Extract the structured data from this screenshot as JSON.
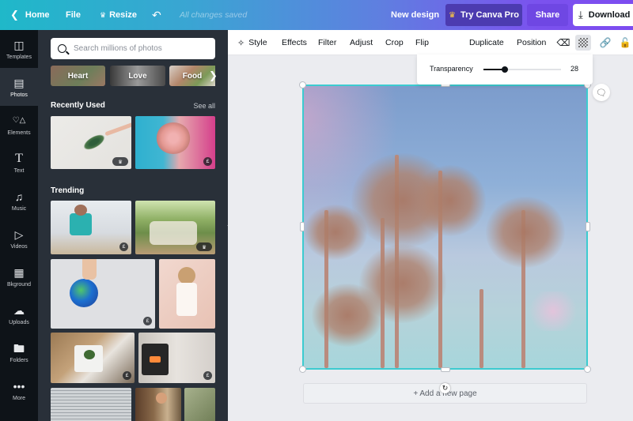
{
  "topbar": {
    "home": "Home",
    "file": "File",
    "resize": "Resize",
    "save_status": "All changes saved",
    "new_design": "New design",
    "try_pro": "Try Canva Pro",
    "share": "Share",
    "download": "Download"
  },
  "rail": {
    "items": [
      {
        "label": "Templates",
        "icon": "template-icon"
      },
      {
        "label": "Photos",
        "icon": "photo-icon"
      },
      {
        "label": "Elements",
        "icon": "shapes-icon"
      },
      {
        "label": "Text",
        "icon": "text-icon"
      },
      {
        "label": "Music",
        "icon": "music-icon"
      },
      {
        "label": "Videos",
        "icon": "video-icon"
      },
      {
        "label": "Bkground",
        "icon": "background-icon"
      },
      {
        "label": "Uploads",
        "icon": "upload-cloud-icon"
      },
      {
        "label": "Folders",
        "icon": "folder-icon"
      },
      {
        "label": "More",
        "icon": "more-icon"
      }
    ],
    "active": "Photos"
  },
  "panel": {
    "search_placeholder": "Search millions of photos",
    "chips": [
      "Heart",
      "Love",
      "Food"
    ],
    "recently_used_title": "Recently Used",
    "see_all": "See all",
    "trending_title": "Trending",
    "recent": [
      {
        "desc": "hand holding palm leaf",
        "badge": "pro"
      },
      {
        "desc": "woman holding pink roses",
        "badge": "£"
      }
    ],
    "trending": [
      {
        "desc": "man cooking in kitchen",
        "badge": "£"
      },
      {
        "desc": "friends at outdoor picnic",
        "badge": "pro"
      },
      {
        "desc": "hands holding earth globe",
        "badge": "£"
      },
      {
        "desc": "woman in white shirt by pink wall",
        "badge": ""
      },
      {
        "desc": "washing vegetables in sink",
        "badge": "£"
      },
      {
        "desc": "woman by wood stove",
        "badge": "£"
      },
      {
        "desc": "child by window blinds",
        "badge": ""
      },
      {
        "desc": "smiling chef",
        "badge": ""
      },
      {
        "desc": "plants",
        "badge": ""
      }
    ],
    "badge_glyphs": {
      "pro": "♛",
      "£": "£"
    }
  },
  "toolbar": {
    "style": "Style",
    "effects": "Effects",
    "filter": "Filter",
    "adjust": "Adjust",
    "crop": "Crop",
    "flip": "Flip",
    "duplicate": "Duplicate",
    "position": "Position"
  },
  "transparency": {
    "label": "Transparency",
    "value": 28,
    "value_text": "28",
    "max": 100
  },
  "canvas": {
    "add_page": "+ Add a new page",
    "selection_color": "#3ccbd0"
  }
}
